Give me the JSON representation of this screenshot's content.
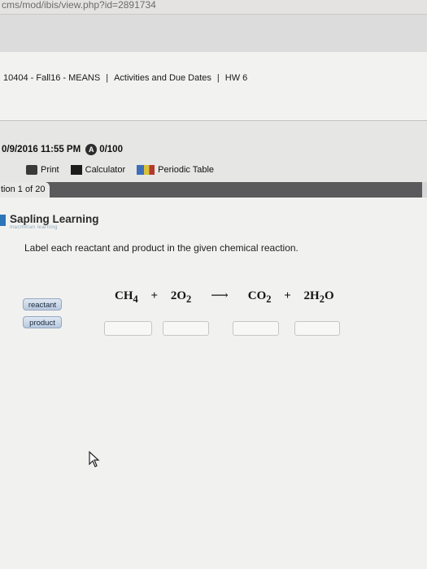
{
  "browser": {
    "url_fragment": "cms/mod/ibis/view.php?id=2891734"
  },
  "breadcrumb": {
    "course": "10404 - Fall16 - MEANS",
    "separator": "|",
    "section": "Activities and Due Dates",
    "assignment": "HW 6"
  },
  "status": {
    "due": "0/9/2016 11:55 PM",
    "badge": "A",
    "score": "0/100"
  },
  "toolbar": {
    "print": "Print",
    "calculator": "Calculator",
    "periodic_table": "Periodic Table"
  },
  "question_tab": {
    "label": "tion 1 of 20"
  },
  "logo": {
    "name": "Sapling Learning",
    "tagline": "macmillan learning"
  },
  "question": {
    "instruction": "Label each reactant and product in the given chemical reaction.",
    "labels": [
      "reactant",
      "product"
    ],
    "equation": {
      "terms": [
        {
          "coef": "",
          "formula": "CH",
          "sub": "4"
        },
        {
          "coef": "2",
          "formula": "O",
          "sub": "2"
        },
        {
          "coef": "",
          "formula": "CO",
          "sub": "2"
        },
        {
          "coef": "2",
          "formula": "H",
          "sub": "2",
          "tail": "O"
        }
      ],
      "plus": "+",
      "arrow": "⟶"
    }
  },
  "icons": [
    "printer-icon",
    "calculator-icon",
    "periodic-table-icon",
    "cursor-icon",
    "lock-icon"
  ]
}
